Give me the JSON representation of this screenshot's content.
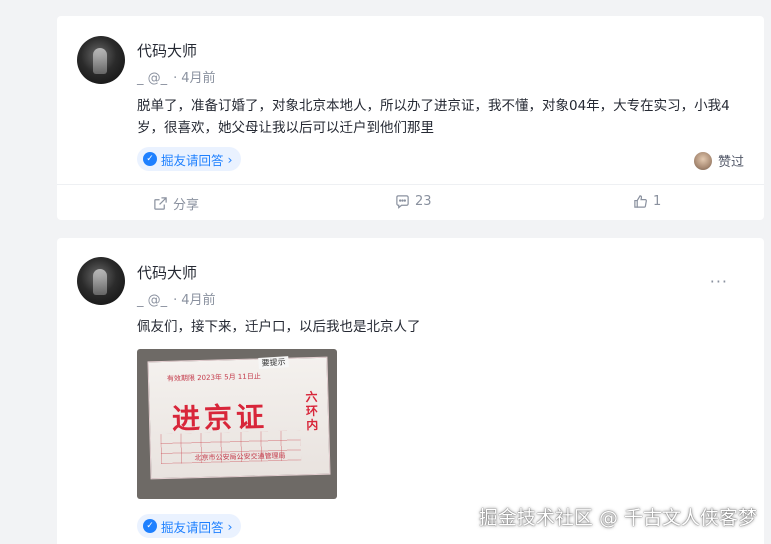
{
  "posts": [
    {
      "author": "代码大师",
      "user_handle": "_ @_",
      "separator": "·",
      "time": "4月前",
      "content": "脱单了，准备订婚了，对象北京本地人，所以办了进京证，我不懂，对象04年，大专在实习，小我4岁，很喜欢，她父母让我以后可以迁户到他们那里",
      "tag_label": "掘友请回答",
      "tag_chevron": "›",
      "liked_label": "赞过",
      "actions": {
        "share_label": "分享",
        "comment_count": "23",
        "like_count": "1"
      }
    },
    {
      "author": "代码大师",
      "user_handle": "_ @_",
      "separator": "·",
      "time": "4月前",
      "more_label": "···",
      "content": "佩友们，接下来，迁户口，以后我也是北京人了",
      "image_text": {
        "title": "进京证",
        "side": "六环内",
        "header": "有效期限  2023年  5月  11日止",
        "footer": "北京市公安局公安交通管理局",
        "bg": "要提示"
      },
      "tag_label": "掘友请回答",
      "tag_chevron": "›"
    }
  ],
  "watermark": "掘金技术社区 @ 千古文人侠客梦",
  "colors": {
    "accent": "#1e80ff",
    "stamp_red": "#d8263a",
    "muted": "#8a919f",
    "background": "#f2f3f5"
  },
  "icons": {
    "share": "share-icon",
    "comment": "comment-icon",
    "like": "thumb-up-icon",
    "tag": "check-circle-icon"
  }
}
